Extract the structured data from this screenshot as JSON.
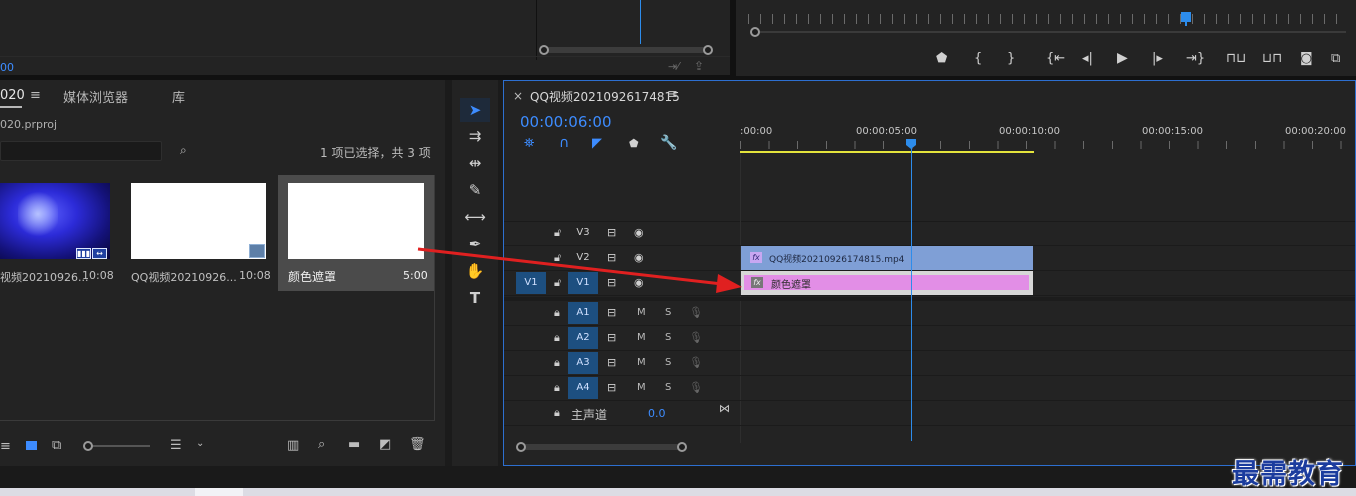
{
  "top": {
    "left_timecode_fragment": "00",
    "monitor_controls": [
      "marker",
      "{",
      "}",
      "go-to-in",
      "step-back",
      "play",
      "step-forward",
      "go-to-out",
      "lift",
      "extract",
      "export-frame",
      "compare"
    ]
  },
  "project": {
    "tab_active": "020",
    "tab_media_browser": "媒体浏览器",
    "tab_library": "库",
    "project_file": "020.prproj",
    "selection_status": "1 项已选择，共 3 项",
    "items": [
      {
        "name": "视频20210926...",
        "duration": "10:08",
        "type": "video"
      },
      {
        "name": "QQ视频20210926...",
        "duration": "10:08",
        "type": "sequence"
      },
      {
        "name": "颜色遮罩",
        "duration": "5:00",
        "type": "matte",
        "selected": true
      }
    ]
  },
  "timeline": {
    "sequence_name": "QQ视频20210926174815",
    "timecode": "00:00:06:00",
    "ruler_labels": [
      ":00:00",
      "00:00:05:00",
      "00:00:10:00",
      "00:00:15:00",
      "00:00:20:00"
    ],
    "video_tracks": [
      {
        "id": "V3",
        "source": ""
      },
      {
        "id": "V2",
        "source": ""
      },
      {
        "id": "V1",
        "source": "V1"
      }
    ],
    "audio_tracks": [
      {
        "id": "A1",
        "m": "M",
        "s": "S"
      },
      {
        "id": "A2",
        "m": "M",
        "s": "S"
      },
      {
        "id": "A3",
        "m": "M",
        "s": "S"
      },
      {
        "id": "A4",
        "m": "M",
        "s": "S"
      }
    ],
    "master": {
      "label": "主声道",
      "value": "0.0"
    },
    "clips": {
      "video_clip": "QQ视频20210926174815.mp4",
      "matte_clip": "颜色遮罩",
      "fx_label": "fx"
    }
  },
  "watermark": "最需教育",
  "colors": {
    "accent": "#2d8ceb",
    "annotation_arrow": "#e02020",
    "matte": "#e28ee6",
    "video_clip": "#7f9fd6"
  }
}
